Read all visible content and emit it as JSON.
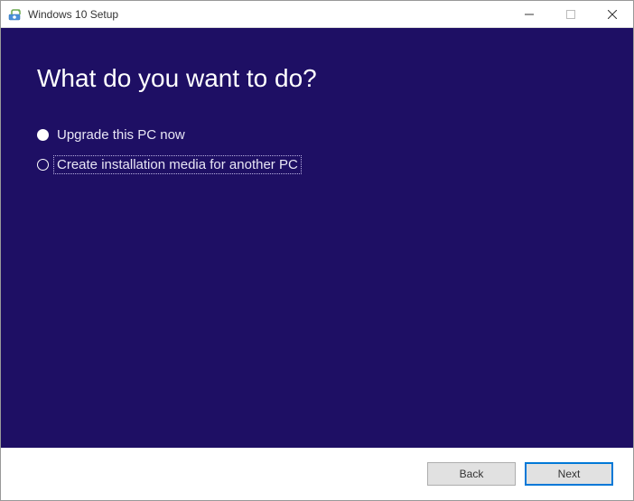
{
  "window": {
    "title": "Windows 10 Setup"
  },
  "main": {
    "heading": "What do you want to do?",
    "options": [
      {
        "label": "Upgrade this PC now",
        "selected": false
      },
      {
        "label": "Create installation media for another PC",
        "selected": true
      }
    ]
  },
  "footer": {
    "back_label": "Back",
    "next_label": "Next"
  }
}
